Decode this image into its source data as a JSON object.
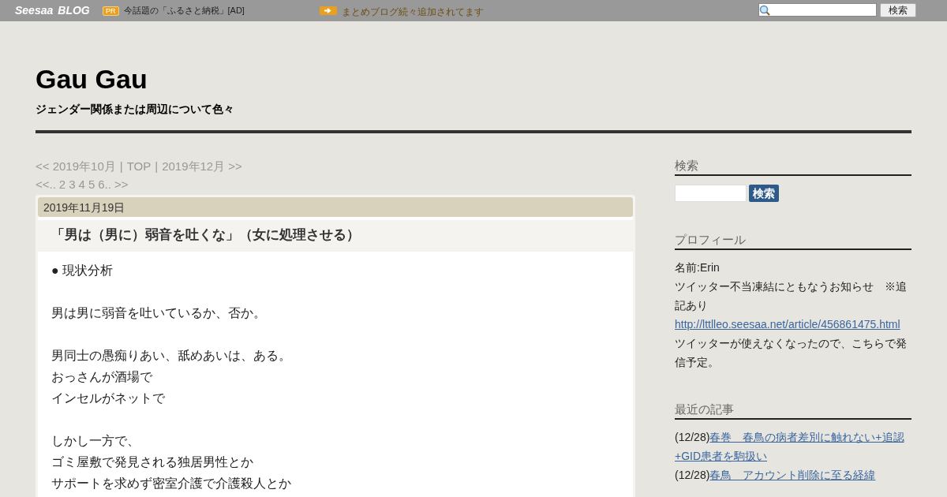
{
  "topbar": {
    "logo_main": "Seesaa",
    "logo_sub": "BLOG",
    "ad_badge": "PR",
    "ad_text": "今話題の「ふるさと納税」[AD]",
    "notice": "まとめブログ続々追加されてます",
    "search_button": "検索"
  },
  "blog": {
    "title": "Gau Gau",
    "subtitle": "ジェンダー関係または周辺について色々"
  },
  "nav": {
    "month_links": [
      {
        "text": "<< 2019年10月"
      },
      {
        "text": "TOP"
      },
      {
        "text": "2019年12月 >>"
      }
    ],
    "separator": "|",
    "pages": [
      "<<..",
      "2",
      "3",
      "4",
      "5",
      "6..",
      ">>"
    ]
  },
  "post": {
    "date": "2019年11月19日",
    "title": "「男は（男に）弱音を吐くな」（女に処理させる）",
    "paragraphs": [
      [
        "● 現状分析"
      ],
      [
        "男は男に弱音を吐いているか、否か。"
      ],
      [
        "男同士の愚痴りあい、舐めあいは、ある。",
        "おっさんが酒場で",
        "インセルがネットで"
      ],
      [
        "しかし一方で、",
        "ゴミ屋敷で発見される独居男性とか",
        "サポートを求めず密室介護で介護殺人とか"
      ]
    ]
  },
  "sidebar": {
    "search": {
      "heading": "検索",
      "button": "検索"
    },
    "profile": {
      "heading": "プロフィール",
      "lines": [
        {
          "kind": "text",
          "text": "名前:Erin"
        },
        {
          "kind": "text",
          "text": "ツイッター不当凍結にともなうお知らせ　※追記あり"
        },
        {
          "kind": "link",
          "text": "http://lttlleo.seesaa.net/article/456861475.html"
        },
        {
          "kind": "text",
          "text": "ツイッターが使えなくなったので、こちらで発信予定。"
        }
      ]
    },
    "recent": {
      "heading": "最近の記事",
      "items": [
        {
          "date": "(12/28)",
          "title": "春巻　春鳥の病者差別に触れない+追認+GID患者を駒扱い"
        },
        {
          "date": "(12/28)",
          "title": "春鳥　アカウント削除に至る経緯"
        }
      ]
    }
  }
}
